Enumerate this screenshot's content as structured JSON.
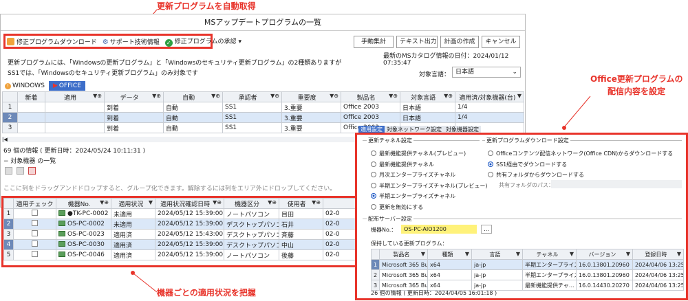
{
  "callouts": {
    "top": "更新プログラムを自動取得",
    "right_line1": "Office更新プログラムの",
    "right_line2": "配信内容を設定",
    "bottom": "機器ごとの適用状況を把握"
  },
  "window": {
    "title": "MSアップデートプログラムの一覧",
    "toolbar": {
      "download": "修正プログラムダウンロード",
      "support": "サポート技術情報",
      "approve": "修正プログラムの承認"
    },
    "buttons": {
      "manual": "手動集計",
      "text_out": "テキスト出力",
      "plan": "計画の作成",
      "cancel": "キャンセル"
    },
    "catalog_date": "最新のMSカタログ情報の日付：2024/01/12 07:35:47",
    "notice_line1": "更新プログラムには、「Windowsの更新プログラム」と「Windowsのセキュリティ更新プログラム」の2種類ありますが",
    "notice_line2": "SS1では、「Windowsのセキュリティ更新プログラム」のみ対象です",
    "lang_label": "対象言語：",
    "lang_value": "日本語",
    "tabs": [
      "WINDOWS",
      "OFFICE"
    ],
    "grid_headers": [
      "新着",
      "適用",
      "データ",
      "自動",
      "承認者",
      "重要度",
      "製品名",
      "対象言語",
      "適用済/対象機器(台)"
    ],
    "grid_rows": [
      {
        "n": "1",
        "data": "到着",
        "auto": "自動",
        "approver": "SS1",
        "severity": "3.重要",
        "product": "Office 2003",
        "lang": "日本語",
        "count": "1/4"
      },
      {
        "n": "2",
        "data": "到着",
        "auto": "自動",
        "approver": "SS1",
        "severity": "3.重要",
        "product": "Office 2003",
        "lang": "日本語",
        "count": "1/4"
      },
      {
        "n": "3",
        "data": "到着",
        "auto": "自動",
        "approver": "SS1",
        "severity": "3.重要",
        "product": "Office 2003",
        "lang": "",
        "count": ""
      }
    ],
    "row3_tabs": [
      "適用設定",
      "対象ネットワーク設定",
      "対象機器設定"
    ],
    "info_count": "69 個の情報 ( 更新日時：2024/05/24 10:11:31 )",
    "target_section": "対象機器 の一覧",
    "drag_hint": "ここに列をドラッグアンドドロップすると、グループ化できます。解除するには列をエリア外にドロップしてください。",
    "device_headers": [
      "適用チェック",
      "機器No.",
      "適用状況",
      "適用状況確認日時",
      "機器区分",
      "使用者",
      ""
    ],
    "device_rows": [
      {
        "n": "1",
        "no": "●TK-PC-0002",
        "status": "未適用",
        "date": "2024/05/12 15:39:00",
        "kind": "ノートパソコン",
        "user": "目田",
        "tail": "02-0"
      },
      {
        "n": "2",
        "no": "OS-PC-0002",
        "status": "未適用",
        "date": "2024/05/12 15:39:00",
        "kind": "デスクトップパソコン",
        "user": "石井",
        "tail": "02-0"
      },
      {
        "n": "3",
        "no": "OS-PC-0023",
        "status": "適用済",
        "date": "2024/05/12 15:43:00",
        "kind": "デスクトップパソコン",
        "user": "斉藤",
        "tail": "02-0"
      },
      {
        "n": "4",
        "no": "OS-PC-0030",
        "status": "適用済",
        "date": "2024/05/12 15:39:00",
        "kind": "デスクトップパソコン",
        "user": "中山",
        "tail": "02-0"
      },
      {
        "n": "5",
        "no": "OS-PC-0046",
        "status": "適用済",
        "date": "2024/05/12 15:39:00",
        "kind": "ノートパソコン",
        "user": "後藤",
        "tail": "02-0"
      }
    ]
  },
  "panel": {
    "channel_title": "更新チャネル設定",
    "channels": [
      "最新機能提供チャネル(プレビュー)",
      "最新機能提供チャネル",
      "月次エンタープライズチャネル",
      "半期エンタープライズチャネル(プレビュー)",
      "半期エンタープライズチャネル",
      "更新を無効にする"
    ],
    "channel_selected": 4,
    "download_title": "更新プログラムダウンロード設定",
    "downloads": [
      "Officeコンテンツ配信ネットワーク(Office CDN)からダウンロードする",
      "SS1経由でダウンロードする",
      "共有フォルダからダウンロードする"
    ],
    "download_selected": 1,
    "share_label": "共有フォルダのパス：",
    "server_title": "配布サーバー設定",
    "machine_label": "機器No.：",
    "machine_value": "OS-PC-AIO1200",
    "browse": "...",
    "held_label": "保持している更新プログラム：",
    "headers": [
      "製品名",
      "種類",
      "言語",
      "チャネル",
      "バージョン",
      "登録日時"
    ],
    "rows": [
      {
        "n": "1",
        "name": "Microsoft 365 Bus...",
        "type": "x64",
        "lang": "ja-jp",
        "channel": "半期エンタープライズ...",
        "ver": "16.0.13801.20960",
        "date": "2024/04/06 13:25..."
      },
      {
        "n": "2",
        "name": "Microsoft 365 Bus...",
        "type": "x64",
        "lang": "ja-jp",
        "channel": "半期エンタープライズ...",
        "ver": "16.0.13801.20960",
        "date": "2024/04/06 13:25..."
      },
      {
        "n": "3",
        "name": "Microsoft 365 Bus...",
        "type": "x64",
        "lang": "ja-jp",
        "channel": "最新機能提供チャ...",
        "ver": "16.0.14430.20270",
        "date": "2024/04/06 13:25..."
      }
    ],
    "footer": "26 個の情報 ( 更新日時：2024/04/05 16:01:18 )"
  },
  "colors": {
    "accent_red": "#e8342b",
    "highlight_yellow": "#fff27a",
    "selected_row": "#dbe8f8"
  }
}
